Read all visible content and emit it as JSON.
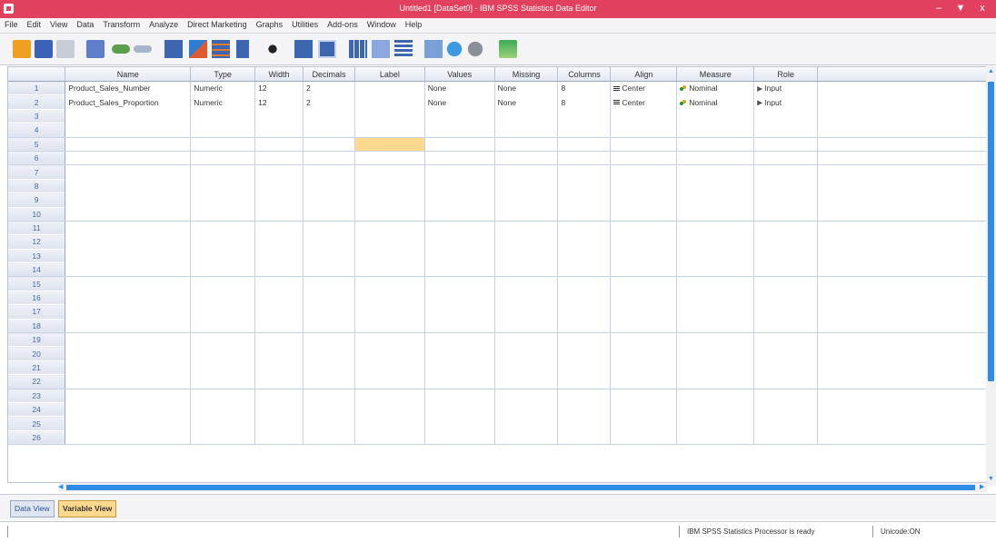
{
  "window": {
    "title": "Untitled1 [DataSet0] - IBM SPSS Statistics Data Editor",
    "min": "–",
    "max": "▼",
    "close": "x"
  },
  "menu": [
    "File",
    "Edit",
    "View",
    "Data",
    "Transform",
    "Analyze",
    "Direct Marketing",
    "Graphs",
    "Utilities",
    "Add-ons",
    "Window",
    "Help"
  ],
  "toolbar": [
    "open-icon",
    "save-icon",
    "print-icon",
    "dialog-recall-icon",
    "undo-icon",
    "redo-icon",
    "goto-case-icon",
    "goto-variable-icon",
    "variables-icon",
    "run-descriptives-icon",
    "find-icon",
    "insert-cases-icon",
    "insert-variable-icon",
    "split-file-icon",
    "weight-cases-icon",
    "select-cases-icon",
    "value-labels-icon",
    "use-sets-icon",
    "show-all-variables-icon",
    "spelling-icon"
  ],
  "columns": [
    "",
    "Name",
    "Type",
    "Width",
    "Decimals",
    "Label",
    "Values",
    "Missing",
    "Columns",
    "Align",
    "Measure",
    "Role"
  ],
  "rows": [
    {
      "num": "1",
      "name": "Product_Sales_Number",
      "type": "Numeric",
      "width": "12",
      "decimals": "2",
      "label": "",
      "values": "None",
      "missing": "None",
      "columns": "8",
      "align": "Center",
      "measure": "Nominal",
      "role": "Input"
    },
    {
      "num": "2",
      "name": "Product_Sales_Proportion",
      "type": "Numeric",
      "width": "12",
      "decimals": "2",
      "label": "",
      "values": "None",
      "missing": "None",
      "columns": "8",
      "align": "Center",
      "measure": "Nominal",
      "role": "Input"
    }
  ],
  "empty_rows": [
    "3",
    "4",
    "5",
    "6",
    "7",
    "8",
    "9",
    "10",
    "11",
    "12",
    "13",
    "14",
    "15",
    "16",
    "17",
    "18",
    "19",
    "20",
    "21",
    "22",
    "23",
    "24",
    "25",
    "26"
  ],
  "tabs": {
    "data_view": "Data View",
    "variable_view": "Variable View"
  },
  "status": {
    "processor": "IBM SPSS Statistics Processor is ready",
    "encoding": "Unicode:ON"
  },
  "colors": {
    "title_bar": "#e2405f",
    "selected_cell": "#fdd98d",
    "scroll_accent": "#2e8be6"
  }
}
